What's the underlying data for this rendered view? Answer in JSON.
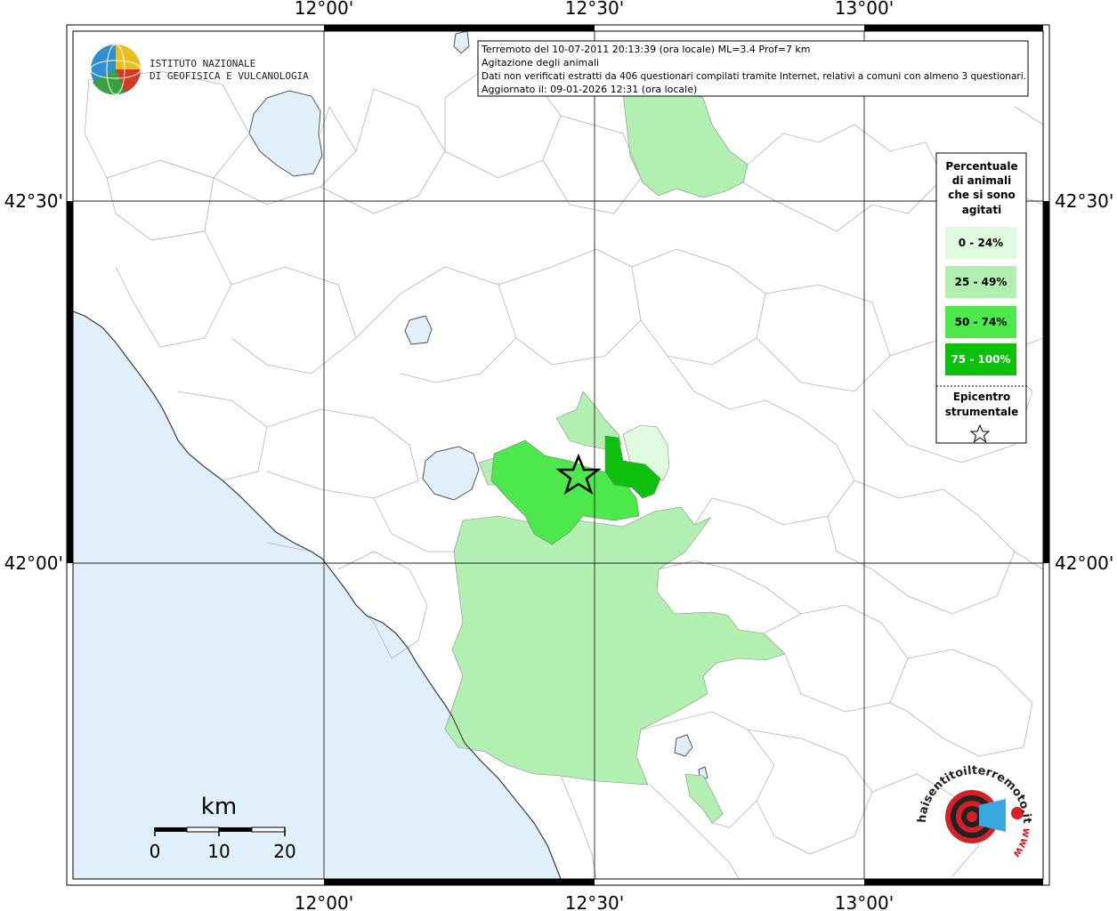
{
  "map": {
    "lon_ticks": [
      "12°00'",
      "12°30'",
      "13°00'"
    ],
    "lat_ticks": [
      "42°30'",
      "42°00'"
    ]
  },
  "institute": {
    "line1": "ISTITUTO NAZIONALE",
    "line2": "DI GEOFISICA E VULCANOLOGIA"
  },
  "info_box": {
    "line1": "Terremoto del 10-07-2011 20:13:39 (ora locale) ML=3.4 Prof=7 km",
    "line2": "Agitazione degli animali",
    "line3": "Dati non verificati estratti da 406 questionari compilati tramite Internet, relativi a comuni con almeno 3 questionari.",
    "line4": "Aggiornato il: 09-01-2026 12:31 (ora locale)"
  },
  "legend": {
    "title": [
      "Percentuale",
      "di animali",
      "che si sono",
      "agitati"
    ],
    "classes": [
      {
        "label": "0 - 24%",
        "color": "#e0fae0"
      },
      {
        "label": "25 - 49%",
        "color": "#b2f0b2"
      },
      {
        "label": "50 - 74%",
        "color": "#4ce84c"
      },
      {
        "label": "75 - 100%",
        "color": "#0cc00c"
      }
    ],
    "epicenter_label": [
      "Epicentro",
      "strumentale"
    ],
    "epicenter_icon": "star-icon"
  },
  "scale_bar": {
    "unit": "km",
    "labels": [
      "0",
      "10",
      "20"
    ]
  },
  "site_logo": {
    "text": "haisentitoilterremoto.it",
    "url_text": "www"
  },
  "colors": {
    "sea": "#dff0fb",
    "lake": "#dff0fb",
    "land": "#ffffff",
    "border": "#b4b4b4"
  }
}
